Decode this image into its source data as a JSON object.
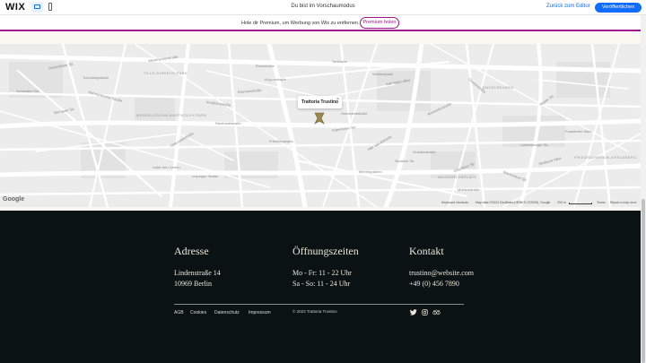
{
  "editor_bar": {
    "logo": "WIX",
    "preview_label": "Du bist im Vorschaumodus",
    "back_link": "Zurück zum Editor",
    "publish_label": "Veröffentlichen"
  },
  "premium_banner": {
    "text": "Hole dir Premium, um Werbung von Wix zu entfernen.",
    "button": "Premium holen"
  },
  "map": {
    "popup_title": "Trattoria Trustino",
    "close_glyph": "×",
    "google_logo": "Google",
    "keyboard_shortcuts": "Keyboard shortcuts",
    "map_data": "Map data ©2024 GeoBasis-DE/BKG (©2009), Google",
    "scale": "200 m",
    "terms": "Terms",
    "report": "Report a map error",
    "streets": [
      "Rosenthaler Str.",
      "Tucholskystraße",
      "Weinmeisterstraße",
      "Rochstraße",
      "Torstraße",
      "Auguststraße",
      "Brunnenstraße",
      "Invalidenstraße",
      "Schwedter Str.",
      "Bernauer Str.",
      "Hannoversche Straße",
      "Reinhardtstraße",
      "Chausseestraße",
      "Friedrichstraße",
      "Unter den Linden",
      "Leipziger Straße",
      "Karl-Marx-Allee",
      "Grunerstraße",
      "Alexanderstraße",
      "Holzmarktstraße",
      "Köpenicker Str.",
      "Alte Jakobstraße",
      "Oranienstraße",
      "Skalitzer Str.",
      "Gitschiner Str.",
      "Mehringdamm",
      "Warschauer Str.",
      "Rigaer Str.",
      "Frankfurter Allee",
      "Lichtenberger Str.",
      "Stralauer Allee",
      "Waldeckpark",
      "Mühlenstraße"
    ],
    "districts": [
      "TILLE-DURIEUX-PARK",
      "MENDELSSOHN-BARTHOLDY-PARK",
      "FRIEDRICHSHAIN-KREUZBERG",
      "ENGELBECKEN",
      "WASSERTORPLATZ"
    ]
  },
  "footer": {
    "address": {
      "heading": "Adresse",
      "line1": "Lindenstraße 14",
      "line2": "10969 Berlin"
    },
    "hours": {
      "heading": "Öffnungszeiten",
      "line1": "Mo - Fr: 11 - 22 Uhr",
      "line2": "Sa - So: 11 - 24 Uhr"
    },
    "contact": {
      "heading": "Kontakt",
      "email": "trustino@website.com",
      "phone": "+49 (0) 456 7890"
    },
    "links": [
      "AGB",
      "Cookies",
      "Datenschutz",
      "Impressum"
    ],
    "copyright": "© 2023 Trattoria Trustino",
    "social_icons": [
      "twitter-icon",
      "instagram-icon",
      "tripadvisor-icon"
    ]
  },
  "colors": {
    "accent": "#116dff",
    "premium": "#a0138e",
    "footer_bg": "#0a1214",
    "footer_text": "#ede6d8",
    "pin": "#9b8a4a"
  }
}
